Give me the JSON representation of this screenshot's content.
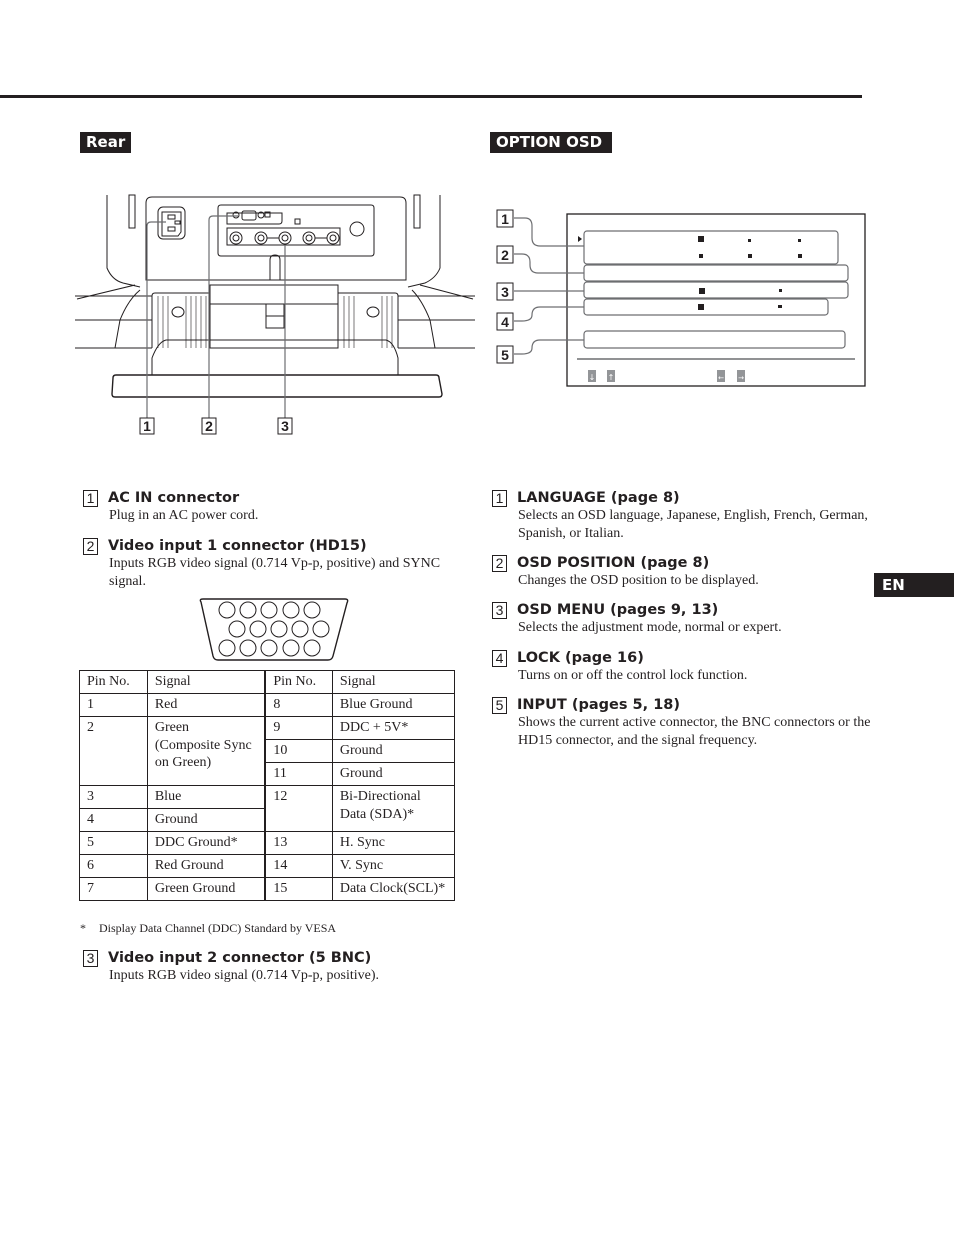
{
  "page": {
    "section_rear": "Rear",
    "section_osd": "OPTION OSD",
    "language_tab": "EN"
  },
  "rear_figure": {
    "callouts": [
      "1",
      "2",
      "3"
    ]
  },
  "osd_figure": {
    "callouts": [
      "1",
      "2",
      "3",
      "4",
      "5"
    ],
    "nav_keys": [
      "↓",
      "↑",
      "←",
      "→"
    ]
  },
  "rear_items": [
    {
      "num": "1",
      "title": "AC IN connector",
      "body": "Plug in an AC power cord."
    },
    {
      "num": "2",
      "title": "Video input 1 connector (HD15)",
      "body": "Inputs RGB video signal (0.714 Vp-p, positive) and SYNC signal."
    },
    {
      "num": "3",
      "title": "Video input 2 connector (5 BNC)",
      "body": "Inputs RGB video signal (0.714 Vp-p, positive)."
    }
  ],
  "pin_table": {
    "headers": [
      "Pin No.",
      "Signal",
      "Pin No.",
      "Signal"
    ],
    "left": [
      {
        "pin": "1",
        "signal": "Red"
      },
      {
        "pin": "2",
        "signal": "Green (Composite Sync on Green)"
      },
      {
        "pin": "3",
        "signal": "Blue"
      },
      {
        "pin": "4",
        "signal": "Ground"
      },
      {
        "pin": "5",
        "signal": "DDC Ground*"
      },
      {
        "pin": "6",
        "signal": "Red Ground"
      },
      {
        "pin": "7",
        "signal": "Green Ground"
      }
    ],
    "right": [
      {
        "pin": "8",
        "signal": "Blue Ground"
      },
      {
        "pin": "9",
        "signal": "DDC + 5V*"
      },
      {
        "pin": "10",
        "signal": "Ground"
      },
      {
        "pin": "11",
        "signal": "Ground"
      },
      {
        "pin": "12",
        "signal": "Bi-Directional Data (SDA)*"
      },
      {
        "pin": "13",
        "signal": "H. Sync"
      },
      {
        "pin": "14",
        "signal": "V. Sync"
      },
      {
        "pin": "15",
        "signal": "Data Clock(SCL)*"
      }
    ]
  },
  "footnote": {
    "mark": "*",
    "text": "Display Data Channel (DDC) Standard by VESA"
  },
  "osd_items": [
    {
      "num": "1",
      "title": "LANGUAGE (page 8)",
      "body": "Selects an OSD language, Japanese, English, French, German, Spanish, or Italian."
    },
    {
      "num": "2",
      "title": "OSD POSITION (page 8)",
      "body": "Changes the OSD position to be displayed."
    },
    {
      "num": "3",
      "title": "OSD MENU (pages 9, 13)",
      "body": "Selects the adjustment mode, normal or expert."
    },
    {
      "num": "4",
      "title": "LOCK (page 16)",
      "body": "Turns on or off the control lock function."
    },
    {
      "num": "5",
      "title": "INPUT (pages 5, 18)",
      "body": "Shows the current active connector, the BNC connectors or the HD15 connector, and the signal frequency."
    }
  ]
}
